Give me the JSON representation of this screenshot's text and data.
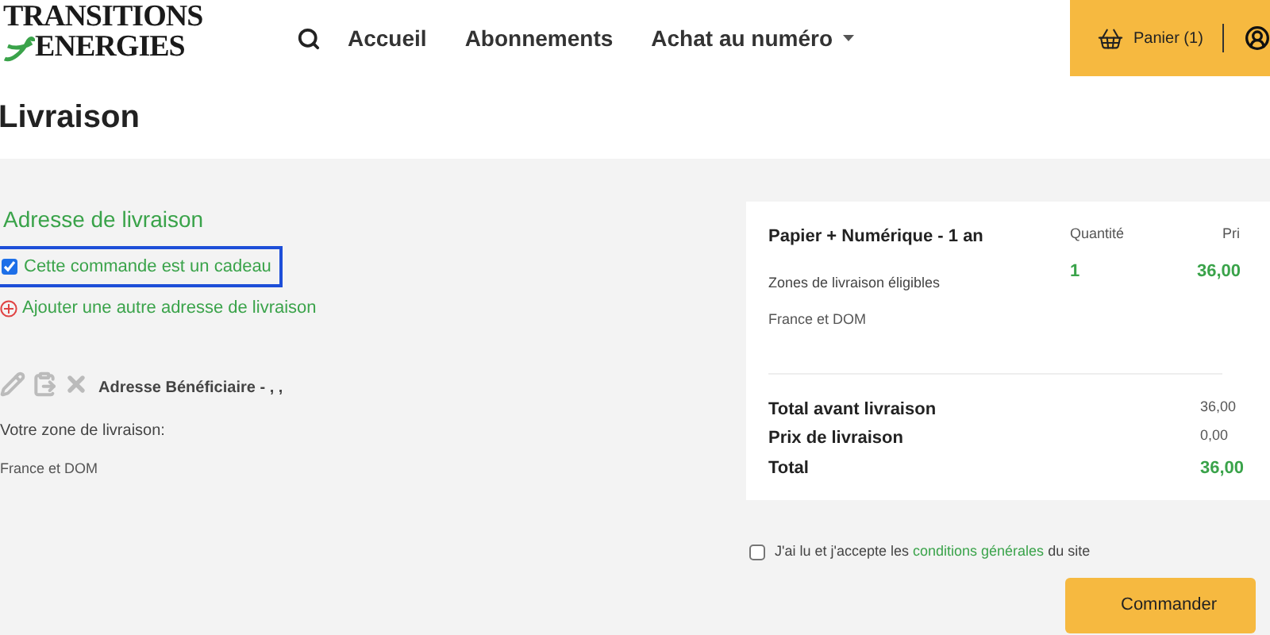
{
  "logo": {
    "line_1": "TRANSITIONS",
    "line_2": "ENERGIES"
  },
  "nav": [
    {
      "label": "Accueil",
      "dropdown": false
    },
    {
      "label": "Abonnements",
      "dropdown": false
    },
    {
      "label": "Achat au numéro",
      "dropdown": true
    }
  ],
  "cart": {
    "label": "Panier (1)"
  },
  "page_title": "Livraison",
  "address": {
    "heading": "Adresse de livraison",
    "gift": {
      "label": "Cette commande est un cadeau",
      "checked": true
    },
    "add_link": "Ajouter une autre adresse de livraison",
    "beneficiary": "Adresse Bénéficiaire - , ,",
    "zone_label": "Votre zone de livraison:",
    "zone_value": "France et DOM"
  },
  "order": {
    "product": "Papier + Numérique - 1 an",
    "eligible_label": "Zones de livraison éligibles",
    "eligible_value": "France et DOM",
    "qty_header": "Quantité",
    "price_header": "Pri",
    "qty": "1",
    "price": "36,00",
    "totals": [
      {
        "label": "Total avant livraison",
        "value": "36,00",
        "highlight": false
      },
      {
        "label": "Prix de livraison",
        "value": "0,00",
        "highlight": false
      },
      {
        "label": "Total",
        "value": "36,00",
        "highlight": true
      }
    ]
  },
  "terms": {
    "before": "J'ai lu et j'accepte les",
    "link": "conditions générales",
    "after": "du site",
    "checked": false
  },
  "submit": "Commander"
}
